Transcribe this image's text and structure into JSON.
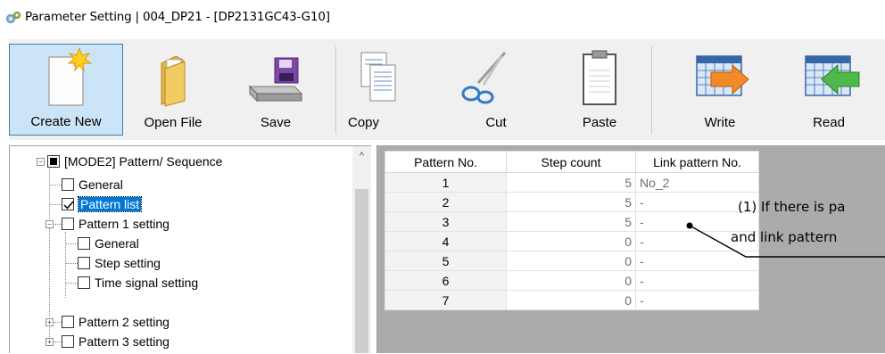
{
  "window": {
    "title": "Parameter Setting  | 004_DP21 - [DP2131GC43-G10]",
    "icon": "settings-app-icon"
  },
  "toolbar": {
    "buttons": [
      {
        "label": "Create New",
        "icon": "new-file-icon",
        "active": true
      },
      {
        "label": "Open File",
        "icon": "folder-icon"
      },
      {
        "label": "Save",
        "icon": "drive-save-icon"
      },
      {
        "label": "Copy",
        "icon": "copy-icon"
      },
      {
        "label": "Cut",
        "icon": "scissors-icon"
      },
      {
        "label": "Paste",
        "icon": "clipboard-icon"
      },
      {
        "label": "Write",
        "icon": "write-arrow-icon"
      },
      {
        "label": "Read",
        "icon": "read-arrow-icon"
      }
    ]
  },
  "tree": {
    "items": [
      {
        "label": "[MODE2] Pattern/ Sequence",
        "state": "partial",
        "expanded": true
      },
      {
        "label": "General",
        "state": "unchecked"
      },
      {
        "label": "Pattern list",
        "state": "checked",
        "selected": true
      },
      {
        "label": "Pattern 1 setting",
        "state": "unchecked",
        "expanded": true
      },
      {
        "label": "General",
        "state": "unchecked"
      },
      {
        "label": "Step setting",
        "state": "unchecked"
      },
      {
        "label": "Time signal setting",
        "state": "unchecked"
      },
      {
        "label": "Pattern 2 setting",
        "state": "unchecked",
        "expanded": false
      },
      {
        "label": "Pattern 3 setting",
        "state": "unchecked",
        "expanded": false
      }
    ],
    "scroll_up_glyph": "^"
  },
  "grid": {
    "columns": [
      "Pattern No.",
      "Step count",
      "Link pattern No."
    ],
    "rows": [
      [
        "1",
        "5",
        "No_2"
      ],
      [
        "2",
        "5",
        "-"
      ],
      [
        "3",
        "5",
        "-"
      ],
      [
        "4",
        "0",
        "-"
      ],
      [
        "5",
        "0",
        "-"
      ],
      [
        "6",
        "0",
        "-"
      ],
      [
        "7",
        "0",
        "-"
      ]
    ]
  },
  "callout": {
    "line1": "(1) If there is pa",
    "line2": "and link pattern"
  },
  "colors": {
    "selection": "#0078d7",
    "active_button_bg": "#cce4f7",
    "grid_empty_bg": "#ababab",
    "toolbar_bg": "#f0f0f0"
  }
}
